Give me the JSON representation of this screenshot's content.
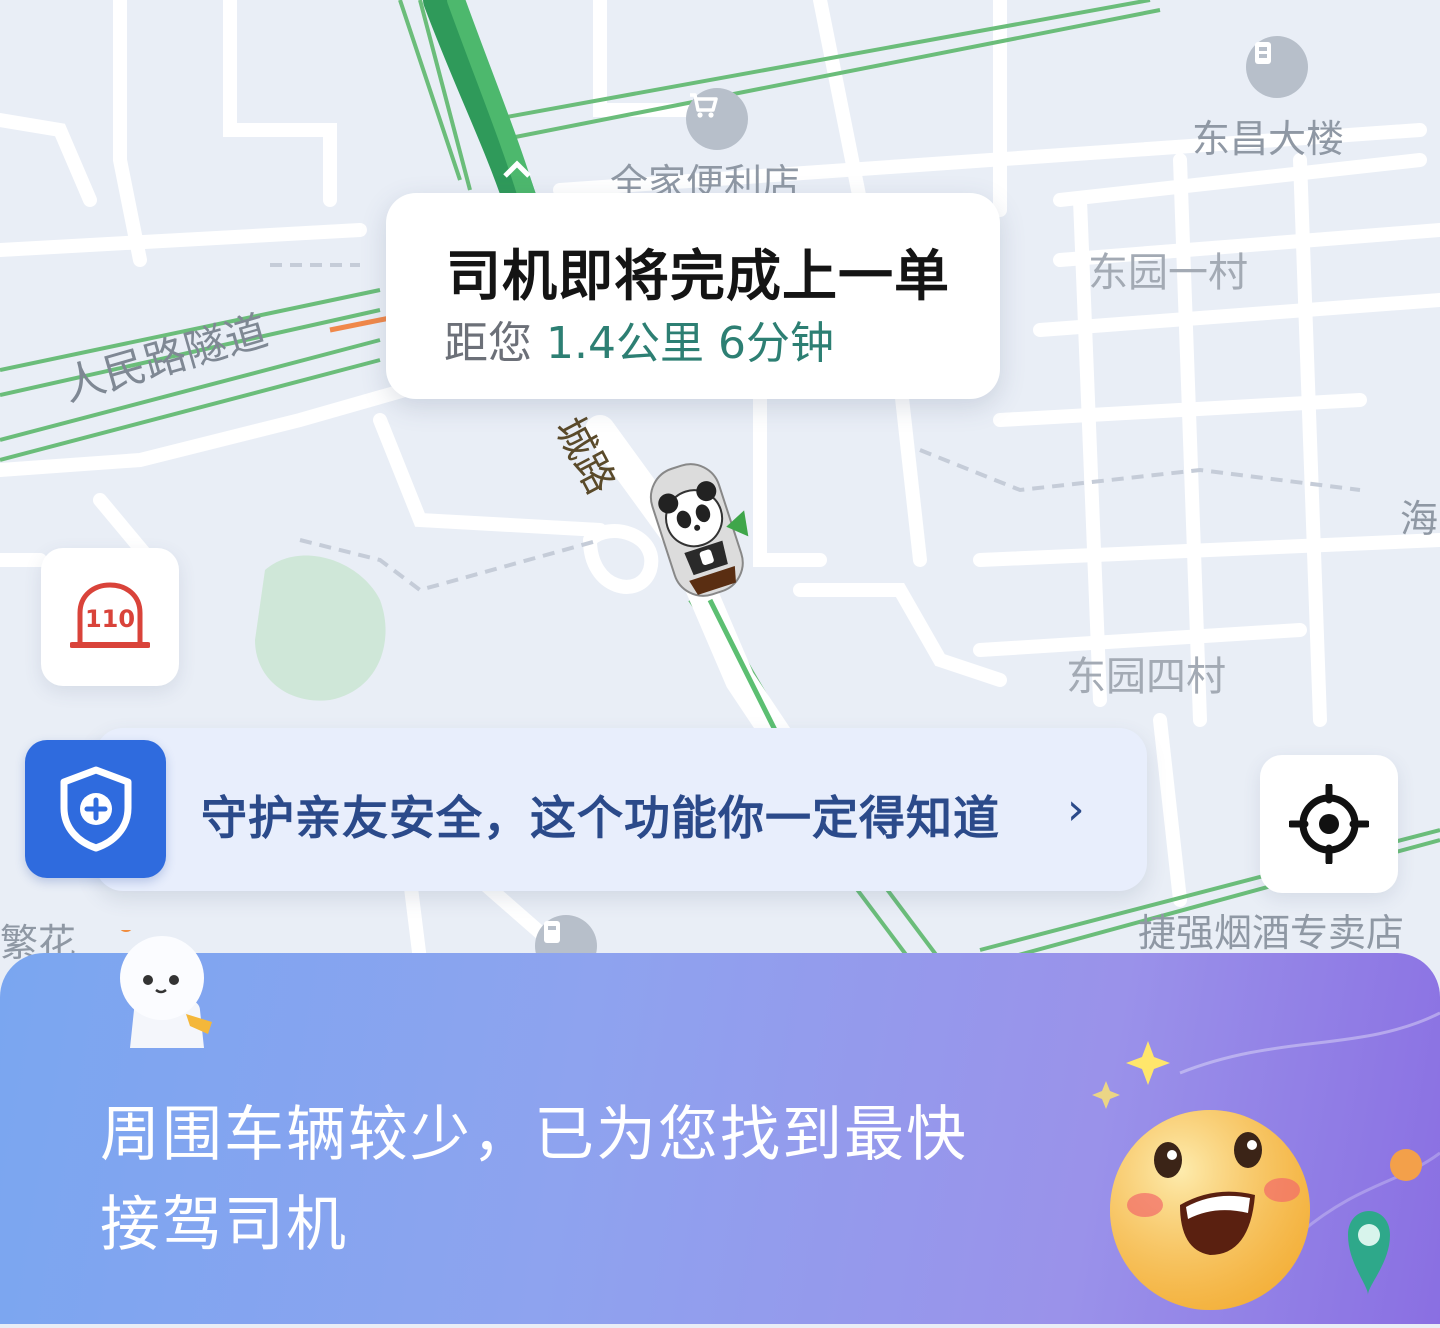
{
  "map": {
    "labels": {
      "tunnel": "人民路隧道",
      "dongchang_building": "东昌大楼",
      "family_mart": "全家便利店",
      "dongyuan_1": "东园一村",
      "dongyuan_4": "东园四村",
      "tobacco_shop": "捷强烟酒专卖店",
      "road_name": "城路",
      "hai": "海",
      "fanhua": "繁花",
      "police_110": "110"
    },
    "icons": [
      "cart-icon",
      "building-icon",
      "police-110-icon",
      "panda-car-icon"
    ]
  },
  "driver_status": {
    "title": "司机即将完成上一单",
    "distance_prefix": "距您",
    "distance": "1.4公里",
    "eta": "6分钟"
  },
  "safety_banner": {
    "text": "守护亲友安全，这个功能你一定得知道",
    "chevron": "›"
  },
  "bottom_panel": {
    "message": "周围车辆较少，已为您找到最快接驾司机"
  },
  "colors": {
    "accent_blue": "#2f6bde",
    "highlight_green": "#2d7f73",
    "route_green": "#4aa864",
    "police_red": "#d9433a"
  }
}
